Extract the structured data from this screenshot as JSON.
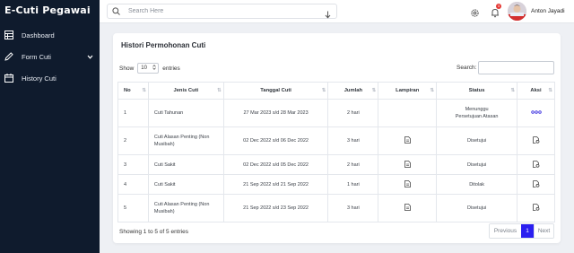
{
  "app": {
    "title": "E-Cuti Pegawai"
  },
  "sidebar": {
    "items": [
      {
        "label": "Dashboard",
        "icon": "dashboard-icon"
      },
      {
        "label": "Form Cuti",
        "icon": "pencil-icon"
      },
      {
        "label": "History Cuti",
        "icon": "calendar-icon"
      }
    ]
  },
  "topbar": {
    "search_placeholder": "Search Here",
    "user_name": "Anton Jayadi",
    "notification_count": "3"
  },
  "card": {
    "title": "Histori Permohonan Cuti",
    "show_label": "Show",
    "entries_value": "10",
    "entries_label": "entries",
    "search_label": "Search:",
    "search_value": ""
  },
  "table": {
    "headers": [
      "No",
      "Jenis Cuti",
      "Tanggal Cuti",
      "Jumlah",
      "Lampiran",
      "Status",
      "Aksi"
    ],
    "rows": [
      {
        "no": "1",
        "jenis": "Cuti Tahunan",
        "tanggal": "27 Mar 2023 s/d 28 Mar 2023",
        "jumlah": "2 hari",
        "lampiran": "",
        "status": "Menunggu Persetujuan Atasan",
        "aksi": "more"
      },
      {
        "no": "2",
        "jenis": "Cuti Alasan Penting (Non Musibah)",
        "tanggal": "02 Dec 2022 s/d 06 Dec 2022",
        "jumlah": "3 hari",
        "lampiran": "file",
        "status": "Disetujui",
        "aksi": "print"
      },
      {
        "no": "3",
        "jenis": "Cuti Sakit",
        "tanggal": "02 Dec 2022 s/d 05 Dec 2022",
        "jumlah": "2 hari",
        "lampiran": "file",
        "status": "Disetujui",
        "aksi": "print"
      },
      {
        "no": "4",
        "jenis": "Cuti Sakit",
        "tanggal": "21 Sep 2022 s/d 21 Sep 2022",
        "jumlah": "1 hari",
        "lampiran": "file",
        "status": "Ditolak",
        "aksi": "print"
      },
      {
        "no": "5",
        "jenis": "Cuti Alasan Penting (Non Musibah)",
        "tanggal": "21 Sep 2022 s/d 23 Sep 2022",
        "jumlah": "3 hari",
        "lampiran": "file",
        "status": "Disetujui",
        "aksi": "print"
      }
    ]
  },
  "footer": {
    "info": "Showing 1 to 5 of 5 entries",
    "previous": "Previous",
    "page": "1",
    "next": "Next"
  },
  "colors": {
    "sidebar_bg": "#0f1b2d",
    "accent": "#2b1ff0",
    "more_icon": "#3b30e0"
  }
}
